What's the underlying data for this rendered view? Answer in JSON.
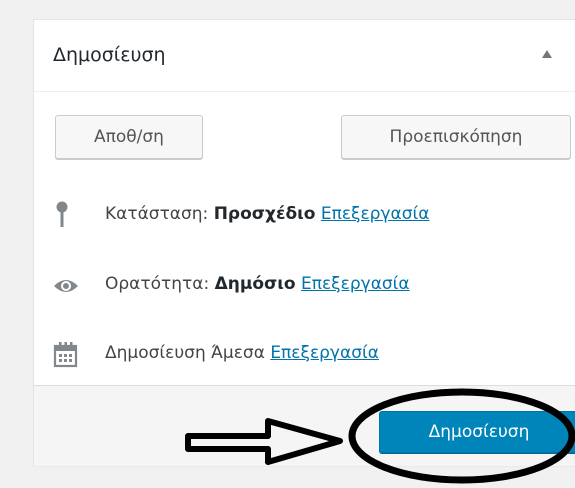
{
  "box": {
    "title": "Δημοσίευση",
    "toggle_icon": "arrow-up-icon"
  },
  "actions": {
    "save_label": "Αποθ/ση",
    "preview_label": "Προεπισκόπηση"
  },
  "status": {
    "icon": "pin-icon",
    "label": "Κατάσταση:",
    "value": "Προσχέδιο",
    "edit_label": "Επεξεργασία"
  },
  "visibility": {
    "icon": "eye-icon",
    "label": "Ορατότητα:",
    "value": "Δημόσιο",
    "edit_label": "Επεξεργασία"
  },
  "schedule": {
    "icon": "calendar-icon",
    "label": "Δημοσίευση",
    "value": "Άμεσα",
    "edit_label": "Επεξεργασία"
  },
  "publish": {
    "label": "Δημοσίευση"
  },
  "colors": {
    "primary": "#0085ba",
    "link": "#0073aa",
    "annotation": "#000000"
  }
}
